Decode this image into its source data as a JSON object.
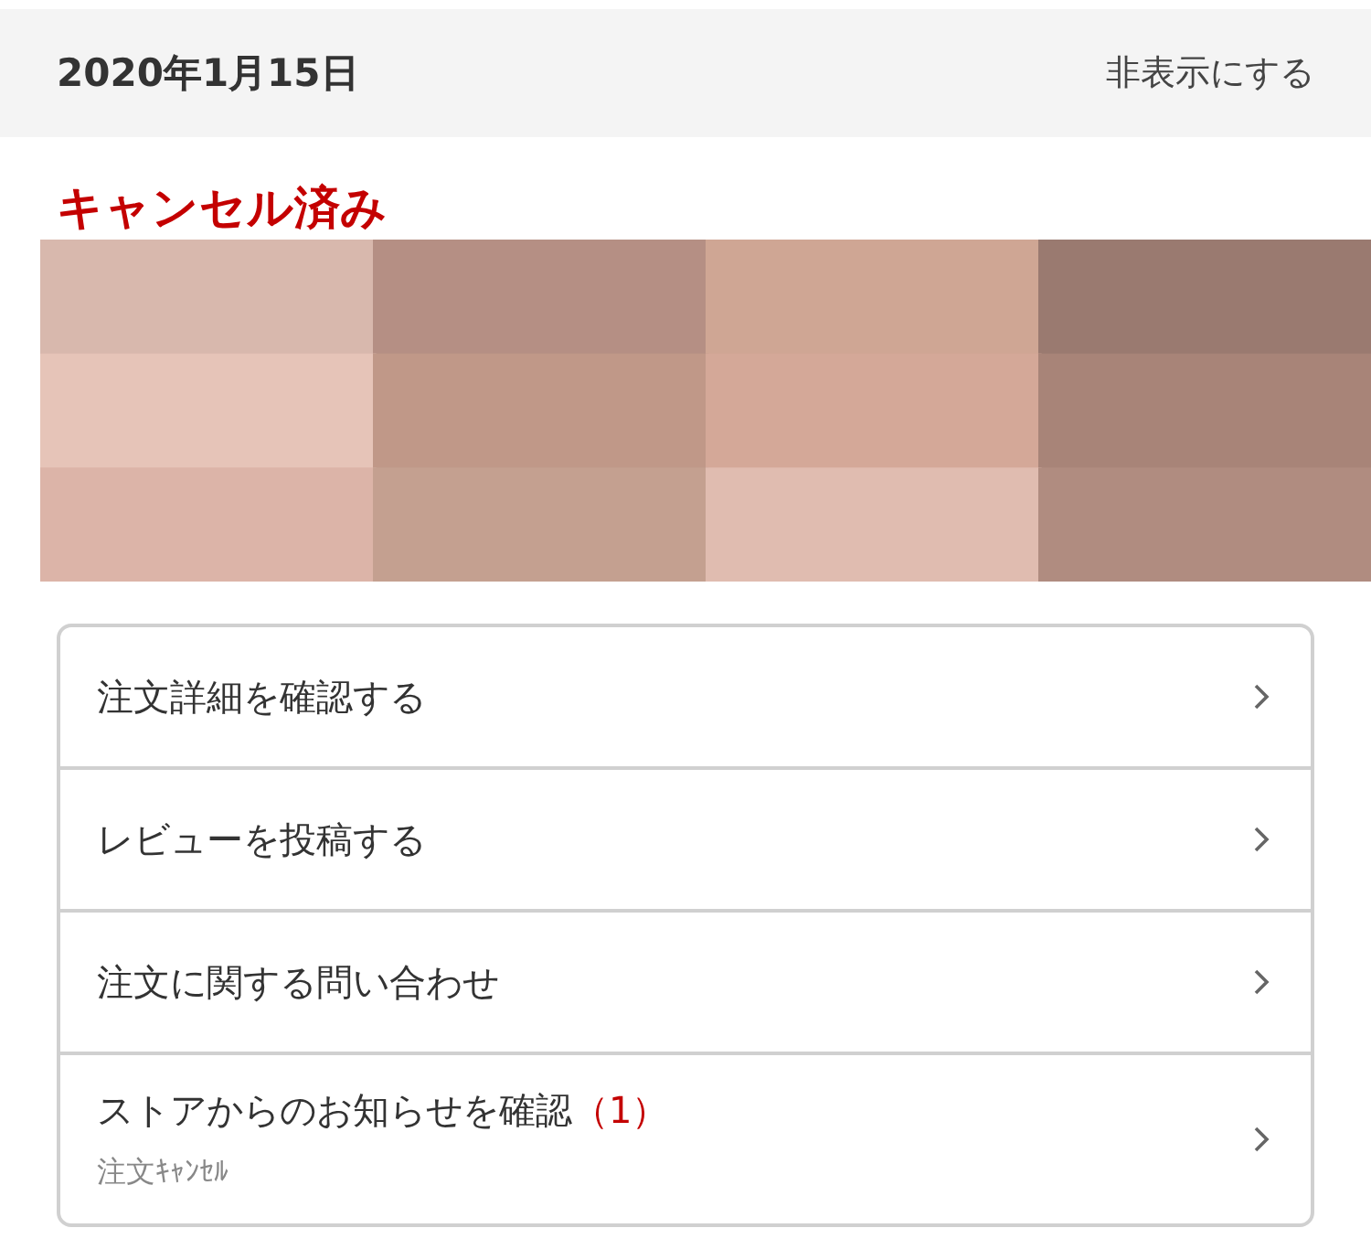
{
  "header": {
    "date": "2020年1月15日",
    "hide_link": "非表示にする"
  },
  "order": {
    "status": "キャンセル済み"
  },
  "menu": [
    {
      "label": "注文詳細を確認する"
    },
    {
      "label": "レビューを投稿する"
    },
    {
      "label": "注文に関する問い合わせ"
    },
    {
      "label": "ストアからのお知らせを確認",
      "count": "（1）",
      "subtitle": "注文ｷｬﾝｾﾙ"
    }
  ]
}
